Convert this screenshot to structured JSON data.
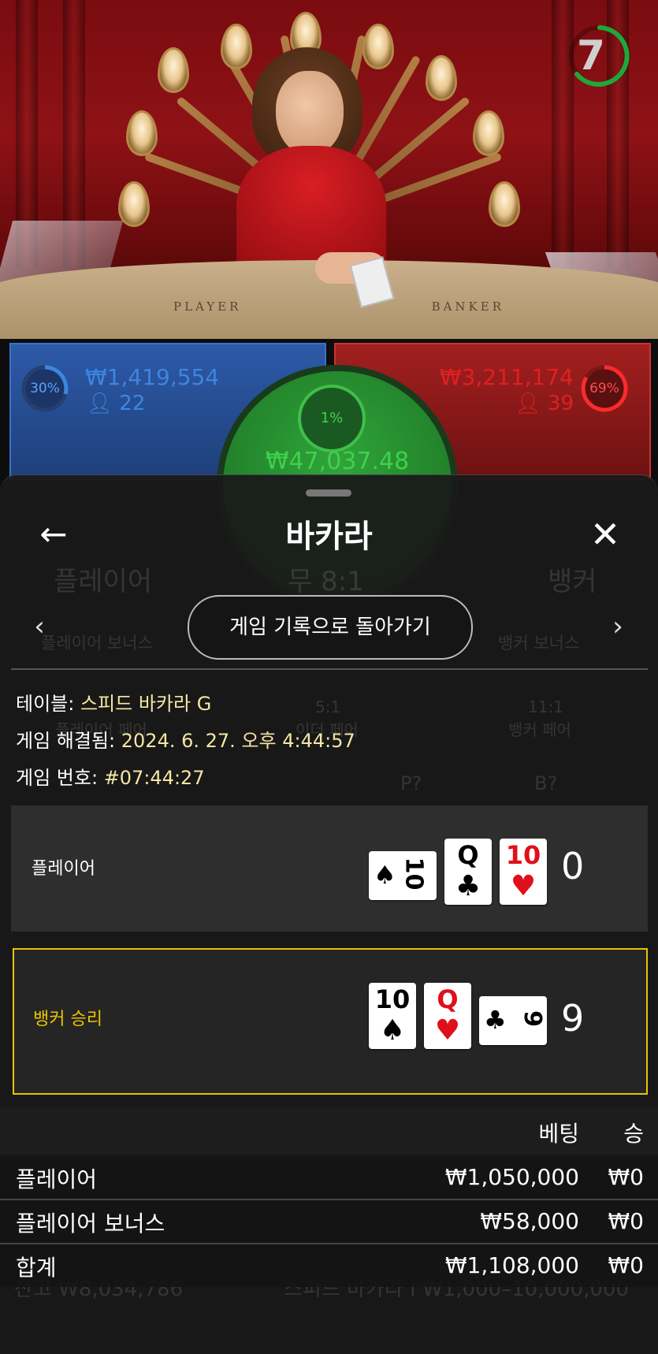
{
  "video": {
    "table_left": "PLAYER",
    "table_right": "BANKER",
    "timer": "7"
  },
  "player_panel": {
    "pct": "30%",
    "amount": "₩1,419,554",
    "players": "22"
  },
  "banker_panel": {
    "pct": "69%",
    "amount": "₩3,211,174",
    "players": "39"
  },
  "tie_panel": {
    "pct": "1%",
    "amount": "₩47,037.48"
  },
  "background_ghost": {
    "player": "플레이어",
    "tie": "무 8:1",
    "banker": "뱅커",
    "player_bonus": "플레이어 보너스",
    "banker_bonus": "뱅커 보너스",
    "pair_odds": "5:1",
    "either_pair": "이더 페어",
    "player_pair": "플레이어 페어",
    "banker_pair_odds": "11:1",
    "banker_pair": "뱅커 페어",
    "p_label": "P?",
    "b_label": "B?",
    "balance": "잔고 ₩8,034,786",
    "table_name": "스피드 바카라 I ₩1,000–10,000,000"
  },
  "sheet": {
    "title": "바카라",
    "history_button": "게임 기록으로 돌아가기",
    "table_label": "테이블:",
    "table_value": "스피드 바카라 G",
    "resolved_label": "게임 해결됨:",
    "resolved_value": "2024. 6. 27. 오후 4:44:57",
    "game_no_label": "게임 번호:",
    "game_no_value": "#07:44:27"
  },
  "results": {
    "player": {
      "label": "플레이어",
      "score": "0",
      "cards": [
        {
          "rank": "10",
          "suit": "♠",
          "color": "#000000",
          "rotated": true
        },
        {
          "rank": "Q",
          "suit": "♣",
          "color": "#000000",
          "rotated": false
        },
        {
          "rank": "10",
          "suit": "♥",
          "color": "#e0101a",
          "rotated": false
        }
      ]
    },
    "banker": {
      "label": "뱅커 승리",
      "score": "9",
      "cards": [
        {
          "rank": "10",
          "suit": "♠",
          "color": "#000000",
          "rotated": false
        },
        {
          "rank": "Q",
          "suit": "♥",
          "color": "#e0101a",
          "rotated": false
        },
        {
          "rank": "9",
          "suit": "♣",
          "color": "#000000",
          "rotated": true
        }
      ]
    }
  },
  "bets": {
    "header_bet": "베팅",
    "header_win": "승",
    "rows": [
      {
        "label": "플레이어",
        "bet": "₩1,050,000",
        "win": "₩0"
      },
      {
        "label": "플레이어 보너스",
        "bet": "₩58,000",
        "win": "₩0"
      },
      {
        "label": "합계",
        "bet": "₩1,108,000",
        "win": "₩0"
      }
    ]
  },
  "colors": {
    "player_blue": "#3d86e0",
    "banker_red": "#e02020",
    "tie_green": "#3fd14c",
    "win_yellow": "#e8c400",
    "info_value": "#f5e6a3"
  }
}
